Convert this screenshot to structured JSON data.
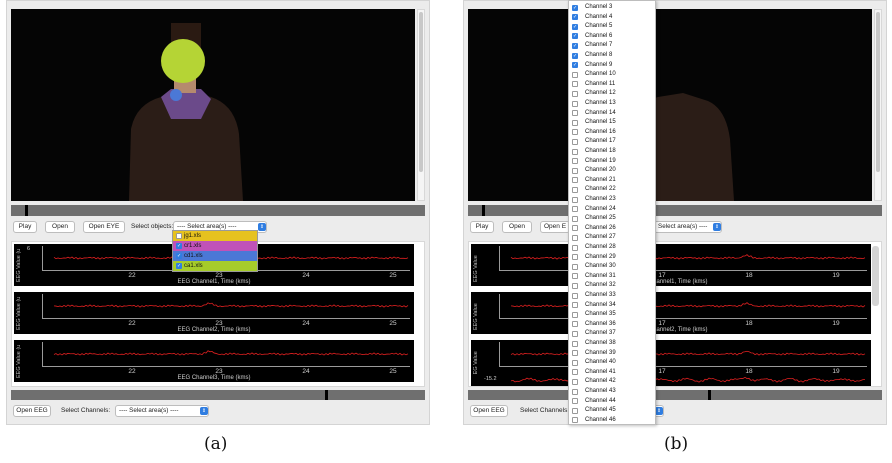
{
  "panel_a": {
    "toolbar": {
      "play_label": "Play",
      "open_label": "Open",
      "open_eye_label": "Open EYE",
      "select_objects_label": "Select objects:",
      "select_objects_value": "---- Select area(s) ----"
    },
    "objects_dropdown": {
      "items": [
        {
          "label": "jg1.xls",
          "checked": false,
          "color": "#e6c21f"
        },
        {
          "label": "cr1.xls",
          "checked": true,
          "color": "#c052b8"
        },
        {
          "label": "cd1.xls",
          "checked": true,
          "color": "#4b78d6"
        },
        {
          "label": "ca1.xls",
          "checked": true,
          "color": "#a6cc2a"
        }
      ]
    },
    "plots": [
      {
        "ylabel": "EEG Value (u",
        "yvalue": "6",
        "xlabel": "EEG Channel1, Time (kms)",
        "ticks": [
          "22",
          "23",
          "24",
          "25"
        ]
      },
      {
        "ylabel": "EEG Value (u",
        "yvalue": "",
        "xlabel": "EEG Channel2, Time (kms)",
        "ticks": [
          "22",
          "23",
          "24",
          "25"
        ]
      },
      {
        "ylabel": "EEG Value (u",
        "yvalue": "",
        "xlabel": "EEG Channel3, Time (kms)",
        "ticks": [
          "22",
          "23",
          "24",
          "25"
        ]
      }
    ],
    "bottom": {
      "open_eeg_label": "Open EEG",
      "select_channels_label": "Select Channels:",
      "select_channels_value": "---- Select area(s) ----"
    },
    "caption": "(a)"
  },
  "panel_b": {
    "toolbar": {
      "play_label": "Play",
      "open_label": "Open",
      "open_eye_label": "Open E",
      "select_objects_value": "Select area(s) ----"
    },
    "plots": [
      {
        "ylabel": "EEG Value",
        "yvalue": "",
        "xlabel": "EEG Channel1, Time (kms)",
        "ticks": [
          "16",
          "17",
          "18",
          "19"
        ]
      },
      {
        "ylabel": "EEG Value",
        "yvalue": "",
        "xlabel": "EEG Channel2, Time (kms)",
        "ticks": [
          "16",
          "17",
          "18",
          "19"
        ]
      },
      {
        "ylabel": "EEG Value",
        "yvalue": "",
        "xlabel": "EEG Channel3, Time (kms)",
        "ticks": [
          "16",
          "17",
          "18",
          "19"
        ]
      },
      {
        "ylabel": "Value",
        "yvalue": "-15.2",
        "xlabel": "",
        "ticks": []
      }
    ],
    "bottom": {
      "open_eeg_label": "Open EEG",
      "select_channels_label": "Select Channels:"
    },
    "caption": "(b)"
  },
  "channel_list": [
    {
      "label": "Channel 3",
      "checked": true
    },
    {
      "label": "Channel 4",
      "checked": true
    },
    {
      "label": "Channel 5",
      "checked": true
    },
    {
      "label": "Channel 6",
      "checked": true
    },
    {
      "label": "Channel 7",
      "checked": true
    },
    {
      "label": "Channel 8",
      "checked": true
    },
    {
      "label": "Channel 9",
      "checked": true
    },
    {
      "label": "Channel 10",
      "checked": false
    },
    {
      "label": "Channel 11",
      "checked": false
    },
    {
      "label": "Channel 12",
      "checked": false
    },
    {
      "label": "Channel 13",
      "checked": false
    },
    {
      "label": "Channel 14",
      "checked": false
    },
    {
      "label": "Channel 15",
      "checked": false
    },
    {
      "label": "Channel 16",
      "checked": false
    },
    {
      "label": "Channel 17",
      "checked": false
    },
    {
      "label": "Channel 18",
      "checked": false
    },
    {
      "label": "Channel 19",
      "checked": false
    },
    {
      "label": "Channel 20",
      "checked": false
    },
    {
      "label": "Channel 21",
      "checked": false
    },
    {
      "label": "Channel 22",
      "checked": false
    },
    {
      "label": "Channel 23",
      "checked": false
    },
    {
      "label": "Channel 24",
      "checked": false
    },
    {
      "label": "Channel 25",
      "checked": false
    },
    {
      "label": "Channel 26",
      "checked": false
    },
    {
      "label": "Channel 27",
      "checked": false
    },
    {
      "label": "Channel 28",
      "checked": false
    },
    {
      "label": "Channel 29",
      "checked": false
    },
    {
      "label": "Channel 30",
      "checked": false
    },
    {
      "label": "Channel 31",
      "checked": false
    },
    {
      "label": "Channel 32",
      "checked": false
    },
    {
      "label": "Channel 33",
      "checked": false
    },
    {
      "label": "Channel 34",
      "checked": false
    },
    {
      "label": "Channel 35",
      "checked": false
    },
    {
      "label": "Channel 36",
      "checked": false
    },
    {
      "label": "Channel 37",
      "checked": false
    },
    {
      "label": "Channel 38",
      "checked": false
    },
    {
      "label": "Channel 39",
      "checked": false
    },
    {
      "label": "Channel 40",
      "checked": false
    },
    {
      "label": "Channel 41",
      "checked": false
    },
    {
      "label": "Channel 42",
      "checked": false
    },
    {
      "label": "Channel 43",
      "checked": false
    },
    {
      "label": "Channel 44",
      "checked": false
    },
    {
      "label": "Channel 45",
      "checked": false
    },
    {
      "label": "Channel 46",
      "checked": false
    }
  ],
  "colors": {
    "accent": "#2f7de1",
    "signal": "#e02020",
    "marker_face": "#b5d435",
    "marker_dot": "#4b78d6"
  },
  "icons": {
    "combo_arrow": "chevron-updown-icon",
    "checkbox": "check-icon"
  }
}
